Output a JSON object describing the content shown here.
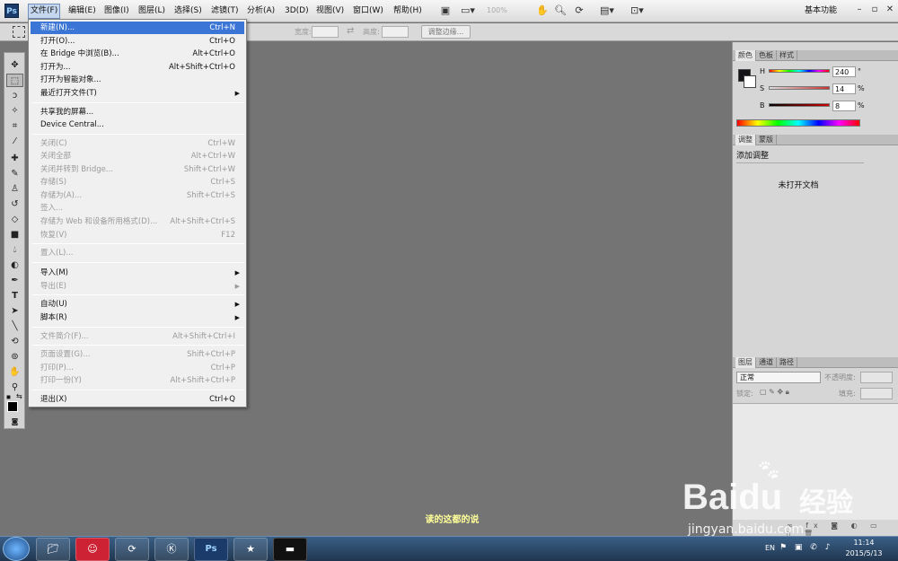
{
  "app": {
    "logo": "Ps"
  },
  "menubar": {
    "items": [
      "文件(F)",
      "编辑(E)",
      "图像(I)",
      "图层(L)",
      "选择(S)",
      "滤镜(T)",
      "分析(A)",
      "3D(D)",
      "视图(V)",
      "窗口(W)",
      "帮助(H)"
    ],
    "zoom": "100%",
    "workspace": "基本功能"
  },
  "options": {
    "width_label": "宽度:",
    "height_label": "高度:",
    "refine_button": "调整边缘..."
  },
  "file_menu": {
    "items": [
      {
        "label": "新建(N)...",
        "shortcut": "Ctrl+N"
      },
      {
        "label": "打开(O)...",
        "shortcut": "Ctrl+O"
      },
      {
        "label": "在 Bridge 中浏览(B)...",
        "shortcut": "Alt+Ctrl+O"
      },
      {
        "label": "打开为...",
        "shortcut": "Alt+Shift+Ctrl+O"
      },
      {
        "label": "打开为智能对象...",
        "shortcut": ""
      },
      {
        "label": "最近打开文件(T)",
        "shortcut": ""
      },
      {
        "label": "共享我的屏幕...",
        "shortcut": ""
      },
      {
        "label": "Device Central...",
        "shortcut": ""
      },
      {
        "label": "关闭(C)",
        "shortcut": "Ctrl+W"
      },
      {
        "label": "关闭全部",
        "shortcut": "Alt+Ctrl+W"
      },
      {
        "label": "关闭并转到 Bridge...",
        "shortcut": "Shift+Ctrl+W"
      },
      {
        "label": "存储(S)",
        "shortcut": "Ctrl+S"
      },
      {
        "label": "存储为(A)...",
        "shortcut": "Shift+Ctrl+S"
      },
      {
        "label": "签入...",
        "shortcut": ""
      },
      {
        "label": "存储为 Web 和设备所用格式(D)...",
        "shortcut": "Alt+Shift+Ctrl+S"
      },
      {
        "label": "恢复(V)",
        "shortcut": "F12"
      },
      {
        "label": "置入(L)...",
        "shortcut": ""
      },
      {
        "label": "导入(M)",
        "shortcut": ""
      },
      {
        "label": "导出(E)",
        "shortcut": ""
      },
      {
        "label": "自动(U)",
        "shortcut": ""
      },
      {
        "label": "脚本(R)",
        "shortcut": ""
      },
      {
        "label": "文件简介(F)...",
        "shortcut": "Alt+Shift+Ctrl+I"
      },
      {
        "label": "页面设置(G)...",
        "shortcut": "Shift+Ctrl+P"
      },
      {
        "label": "打印(P)...",
        "shortcut": "Ctrl+P"
      },
      {
        "label": "打印一份(Y)",
        "shortcut": "Alt+Shift+Ctrl+P"
      },
      {
        "label": "退出(X)",
        "shortcut": "Ctrl+Q"
      }
    ]
  },
  "color_panel": {
    "tabs": [
      "颜色",
      "色板",
      "样式"
    ],
    "h_label": "H",
    "h_value": "240",
    "h_unit": "°",
    "s_label": "S",
    "s_value": "14",
    "s_unit": "%",
    "b_label": "B",
    "b_value": "8",
    "b_unit": "%"
  },
  "adjust_panel": {
    "tabs": [
      "调整",
      "蒙版"
    ],
    "title": "添加调整",
    "empty_text": "未打开文档"
  },
  "layers_panel": {
    "tabs": [
      "图层",
      "通道",
      "路径"
    ],
    "blend_mode": "正常",
    "opacity_label": "不透明度:",
    "lock_label": "锁定:",
    "fill_label": "填充:"
  },
  "caption": "读的这都的说",
  "taskbar": {
    "time": "11:14",
    "date": "2015/5/13",
    "lang": "EN"
  },
  "watermark": {
    "brand": "Baidu",
    "brand_cn": "经验",
    "url": "jingyan.baidu.com"
  }
}
